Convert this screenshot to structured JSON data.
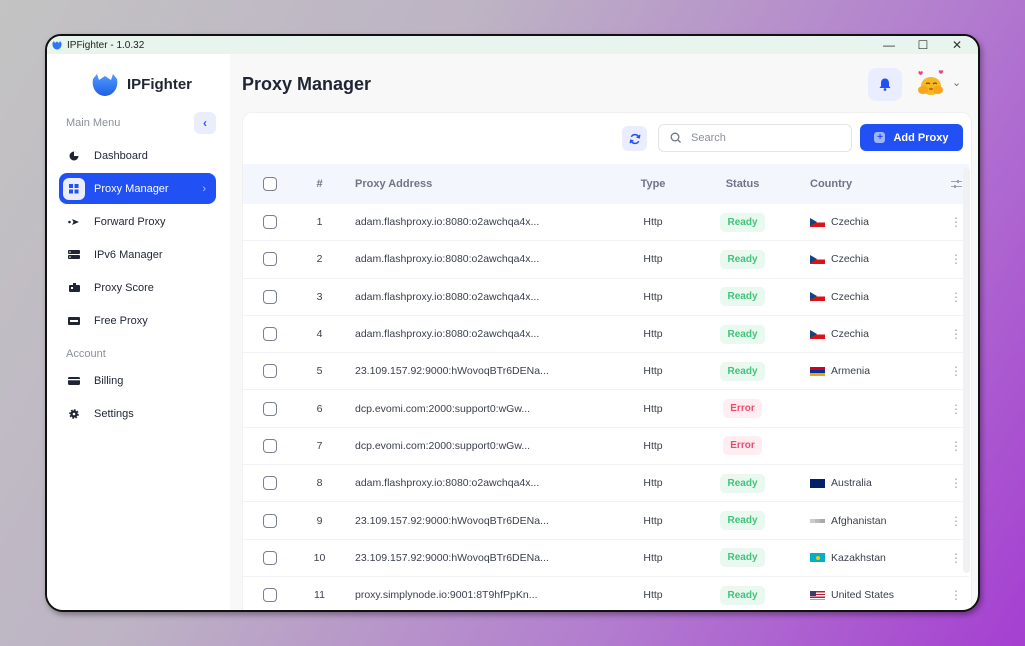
{
  "window": {
    "title": "IPFighter - 1.0.32",
    "controls": {
      "minimize": "—",
      "maximize": "☐",
      "close": "✕"
    }
  },
  "sidebar": {
    "brand": "IPFighter",
    "main_menu_label": "Main Menu",
    "account_label": "Account",
    "main_items": [
      {
        "label": "Dashboard",
        "icon": "pie-chart-icon",
        "active": false
      },
      {
        "label": "Proxy Manager",
        "icon": "grid-icon",
        "active": true
      },
      {
        "label": "Forward Proxy",
        "icon": "arrow-forward-icon",
        "active": false
      },
      {
        "label": "IPv6 Manager",
        "icon": "server-icon",
        "active": false
      },
      {
        "label": "Proxy Score",
        "icon": "score-icon",
        "active": false
      },
      {
        "label": "Free Proxy",
        "icon": "ticket-icon",
        "active": false
      }
    ],
    "account_items": [
      {
        "label": "Billing",
        "icon": "credit-card-icon"
      },
      {
        "label": "Settings",
        "icon": "gear-icon"
      }
    ]
  },
  "header": {
    "title": "Proxy Manager"
  },
  "toolbar": {
    "search_placeholder": "Search",
    "search_value": "",
    "add_label": "Add Proxy"
  },
  "table": {
    "columns": {
      "num": "#",
      "address": "Proxy Address",
      "type": "Type",
      "status": "Status",
      "country": "Country"
    },
    "rows": [
      {
        "num": "1",
        "address": "adam.flashproxy.io:8080:o2awchqa4x...",
        "type": "Http",
        "status": "Ready",
        "country": "Czechia",
        "flag": "cz"
      },
      {
        "num": "2",
        "address": "adam.flashproxy.io:8080:o2awchqa4x...",
        "type": "Http",
        "status": "Ready",
        "country": "Czechia",
        "flag": "cz"
      },
      {
        "num": "3",
        "address": "adam.flashproxy.io:8080:o2awchqa4x...",
        "type": "Http",
        "status": "Ready",
        "country": "Czechia",
        "flag": "cz"
      },
      {
        "num": "4",
        "address": "adam.flashproxy.io:8080:o2awchqa4x...",
        "type": "Http",
        "status": "Ready",
        "country": "Czechia",
        "flag": "cz"
      },
      {
        "num": "5",
        "address": "23.109.157.92:9000:hWovoqBTr6DENa...",
        "type": "Http",
        "status": "Ready",
        "country": "Armenia",
        "flag": "am"
      },
      {
        "num": "6",
        "address": "dcp.evomi.com:2000:support0:wGw...",
        "type": "Http",
        "status": "Error",
        "country": "",
        "flag": ""
      },
      {
        "num": "7",
        "address": "dcp.evomi.com:2000:support0:wGw...",
        "type": "Http",
        "status": "Error",
        "country": "",
        "flag": ""
      },
      {
        "num": "8",
        "address": "adam.flashproxy.io:8080:o2awchqa4x...",
        "type": "Http",
        "status": "Ready",
        "country": "Australia",
        "flag": "au"
      },
      {
        "num": "9",
        "address": "23.109.157.92:9000:hWovoqBTr6DENa...",
        "type": "Http",
        "status": "Ready",
        "country": "Afghanistan",
        "flag": "af"
      },
      {
        "num": "10",
        "address": "23.109.157.92:9000:hWovoqBTr6DENa...",
        "type": "Http",
        "status": "Ready",
        "country": "Kazakhstan",
        "flag": "kz"
      },
      {
        "num": "11",
        "address": "proxy.simplynode.io:9001:8T9hfPpKn...",
        "type": "Http",
        "status": "Ready",
        "country": "United States",
        "flag": "us"
      }
    ]
  },
  "colors": {
    "accent": "#2150f5",
    "ready_text": "#3fc47a",
    "ready_bg": "#e9f9ef",
    "error_text": "#ef4a6d",
    "error_bg": "#feeef1"
  }
}
